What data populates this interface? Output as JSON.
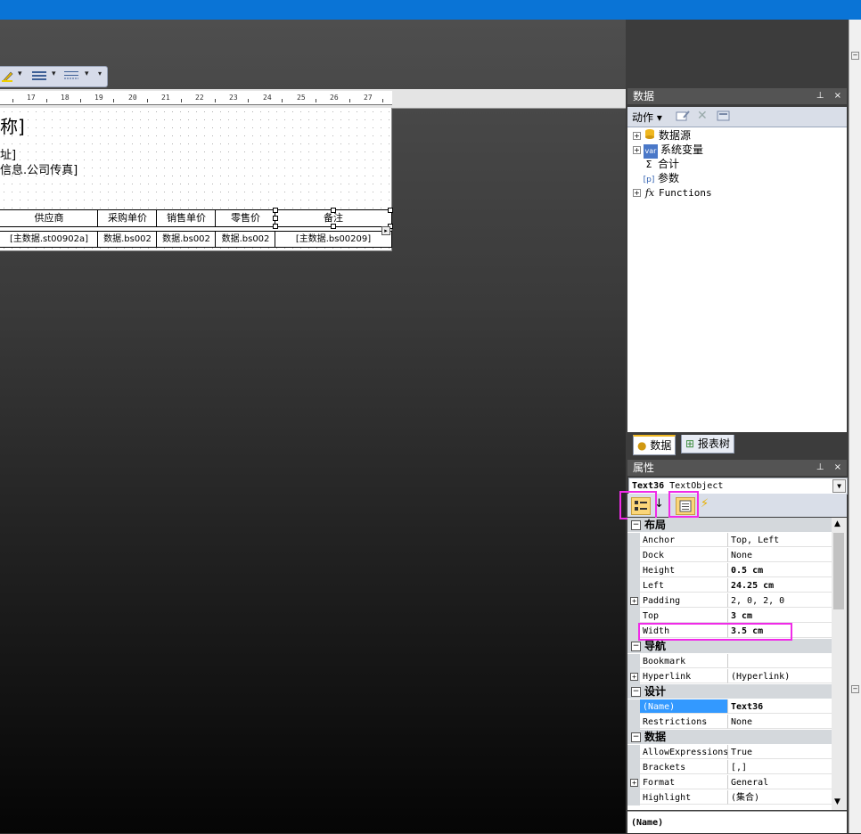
{
  "ruler": {
    "numbers": [
      "17",
      "18",
      "19",
      "20",
      "21",
      "22",
      "23",
      "24",
      "25",
      "26",
      "27"
    ]
  },
  "report": {
    "title": "称]",
    "line1": "址]",
    "line2": "信息.公司传真]",
    "headers": [
      "供应商",
      "采购单价",
      "销售单价",
      "零售价",
      "备注"
    ],
    "cells": [
      "[主数据.st00902a]",
      "数据.bs002",
      "数据.bs002",
      "数据.bs002",
      "[主数据.bs00209]"
    ]
  },
  "data_panel": {
    "title": "数据",
    "pin": "ᵽ",
    "close": "×",
    "action_label": "动作",
    "tree": [
      {
        "label": "数据源",
        "expandable": true,
        "icon": "database-icon"
      },
      {
        "label": "系统变量",
        "expandable": true,
        "icon": "var-icon",
        "icon_text": "var"
      },
      {
        "label": "合计",
        "expandable": false,
        "icon": "sigma-icon",
        "icon_text": "Σ"
      },
      {
        "label": "参数",
        "expandable": false,
        "icon": "parameter-icon",
        "icon_text": "[p]"
      },
      {
        "label": "Functions",
        "expandable": true,
        "icon": "function-icon",
        "icon_text": "fx"
      }
    ],
    "tabs": [
      "数据",
      "报表树"
    ]
  },
  "props_panel": {
    "title": "属性",
    "object_name": "Text36",
    "object_type": "TextObject",
    "categories": {
      "layout": "布局",
      "navigation": "导航",
      "design": "设计",
      "data": "数据"
    },
    "layout_rows": [
      {
        "name": "Anchor",
        "value": "Top, Left",
        "bold": false,
        "expandable": false
      },
      {
        "name": "Dock",
        "value": "None",
        "bold": false,
        "expandable": false
      },
      {
        "name": "Height",
        "value": "0.5 cm",
        "bold": true,
        "expandable": false
      },
      {
        "name": "Left",
        "value": "24.25 cm",
        "bold": true,
        "expandable": false
      },
      {
        "name": "Padding",
        "value": "2, 0, 2, 0",
        "bold": false,
        "expandable": true
      },
      {
        "name": "Top",
        "value": "3 cm",
        "bold": true,
        "expandable": false
      },
      {
        "name": "Width",
        "value": "3.5 cm",
        "bold": true,
        "expandable": false
      }
    ],
    "navigation_rows": [
      {
        "name": "Bookmark",
        "value": "",
        "bold": false,
        "expandable": false
      },
      {
        "name": "Hyperlink",
        "value": "(Hyperlink)",
        "bold": false,
        "expandable": true
      }
    ],
    "design_rows": [
      {
        "name": "(Name)",
        "value": "Text36",
        "bold": true,
        "expandable": false,
        "selected": true
      },
      {
        "name": "Restrictions",
        "value": "None",
        "bold": false,
        "expandable": false
      }
    ],
    "data_rows": [
      {
        "name": "AllowExpressions",
        "value": "True",
        "bold": false,
        "expandable": false
      },
      {
        "name": "Brackets",
        "value": "[,]",
        "bold": false,
        "expandable": false
      },
      {
        "name": "Format",
        "value": "General",
        "bold": false,
        "expandable": true
      },
      {
        "name": "Highlight",
        "value": "(集合)",
        "bold": false,
        "expandable": false
      }
    ],
    "description": "(Name)"
  },
  "colors": {
    "titlebar": "#0a74d6",
    "highlight": "#f02be8",
    "selection": "#3399ff"
  }
}
